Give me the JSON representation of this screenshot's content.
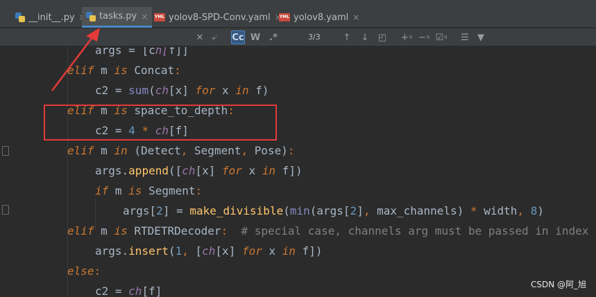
{
  "tabs": [
    {
      "label": "__init__.py",
      "icon": "python-file-icon",
      "active": false
    },
    {
      "label": "tasks.py",
      "icon": "python-file-icon",
      "active": true
    },
    {
      "label": "yolov8-SPD-Conv.yaml",
      "icon": "yaml-file-icon",
      "active": false
    },
    {
      "label": "yolov8.yaml",
      "icon": "yaml-file-icon",
      "active": false
    }
  ],
  "tab_close_glyph": "×",
  "yaml_icon_text": "YML",
  "search": {
    "match_count": "3/3",
    "case_label": "Cc",
    "words_label": "W",
    "regex_label": ".*"
  },
  "code_lines": [
    "args = [ch[f]]",
    "elif m is Concat:",
    "c2 = sum(ch[x] for x in f)",
    "elif m is space_to_depth:",
    "c2 = 4 * ch[f]",
    "elif m in (Detect, Segment, Pose):",
    "args.append([ch[x] for x in f])",
    "if m is Segment:",
    "args[2] = make_divisible(min(args[2], max_channels) * width, 8)",
    "elif m is RTDETRDecoder:  # special case, channels arg must be passed in index",
    "args.insert(1, [ch[x] for x in f])",
    "else:",
    "c2 = ch[f]"
  ],
  "watermark": "CSDN @阿_旭",
  "colors": {
    "annotation_red": "#e43a3a",
    "active_tab_underline": "#4a88c7"
  }
}
